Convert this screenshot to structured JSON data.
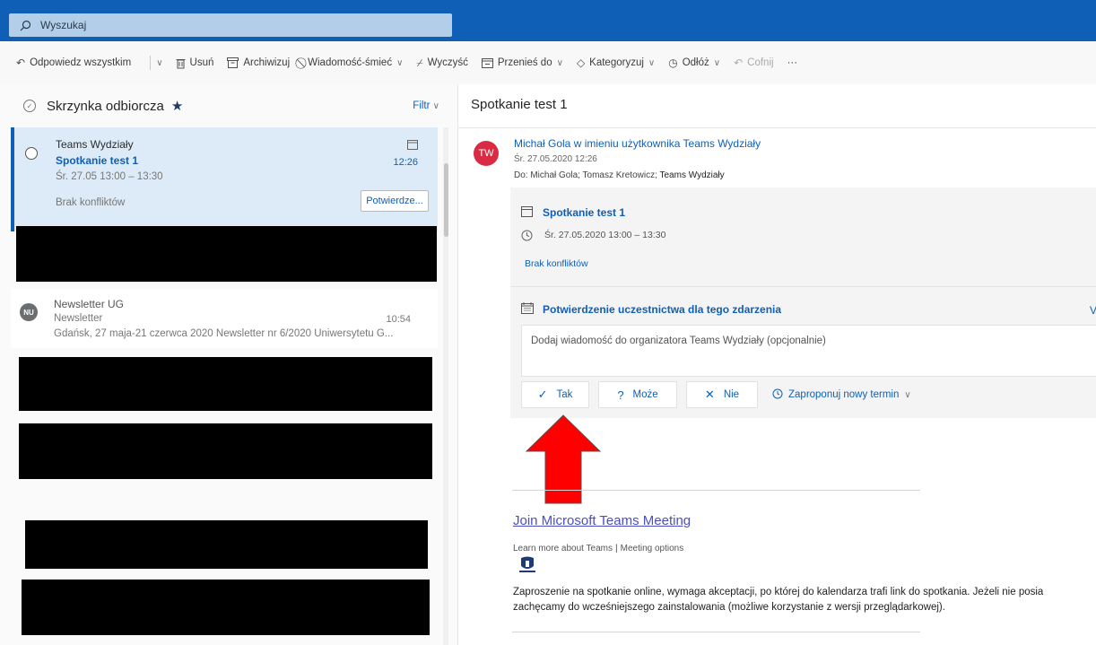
{
  "search": {
    "placeholder": "Wyszukaj"
  },
  "toolbar": {
    "reply_all": "Odpowiedz wszystkim",
    "delete": "Usuń",
    "archive": "Archiwizuj",
    "junk": "Wiadomość-śmieć",
    "sweep": "Wyczyść",
    "move_to": "Przenieś do",
    "categorize": "Kategoryzuj",
    "snooze": "Odłóż",
    "undo": "Cofnij",
    "more": "···"
  },
  "list": {
    "folder_title": "Skrzynka odbiorcza",
    "star": "★",
    "filter": "Filtr",
    "selected": {
      "sender": "Teams Wydziały",
      "subject": "Spotkanie test 1",
      "time_range": "Śr. 27.05 13:00 – 13:30",
      "received": "12:26",
      "conflicts": "Brak konfliktów",
      "confirm_button": "Potwierdze..."
    },
    "newsletter": {
      "avatar": "NU",
      "sender": "Newsletter UG",
      "subject": "Newsletter",
      "received": "10:54",
      "preview": "Gdańsk, 27 maja-21 czerwca 2020 Newsletter nr 6/2020 Uniwersytetu G..."
    }
  },
  "reading": {
    "title": "Spotkanie test 1",
    "avatar": "TW",
    "from": "Michał Gola w imieniu użytkownika Teams Wydziały",
    "date": "Śr. 27.05.2020 12:26",
    "to_label": "Do:",
    "to_list": "Michał Gola; Tomasz Kretowicz;",
    "to_group": "Teams Wydziały",
    "event_title": "Spotkanie test 1",
    "event_time": "Śr. 27.05.2020 13:00 – 13:30",
    "conflicts": "Brak konfliktów",
    "response_header": "Potwierdzenie uczestnictwa dla tego zdarzenia",
    "response_extra": "V",
    "message_placeholder": "Dodaj wiadomość do organizatora Teams Wydziały (opcjonalnie)",
    "btn_yes": "Tak",
    "btn_maybe": "Może",
    "btn_no": "Nie",
    "propose": "Zaproponuj nowy termin",
    "join_link": "Join Microsoft Teams Meeting",
    "learn_more": "Learn more about Teams",
    "meeting_options": "Meeting options",
    "body_line1": "Zaproszenie na spotkanie online, wymaga akceptacji, po której do kalendarza trafi link do spotkania. Jeżeli nie posia",
    "body_line2": "zachęcamy do wcześniejszego zainstalowania (możliwe korzystanie z wersji przeglądarkowej)."
  },
  "colors": {
    "brand": "#0f5fb6",
    "selected_bg": "#dcebf7",
    "avatar_red": "#d92b44",
    "arrow_red": "#ff0000",
    "join_link": "#4b4fbd"
  }
}
